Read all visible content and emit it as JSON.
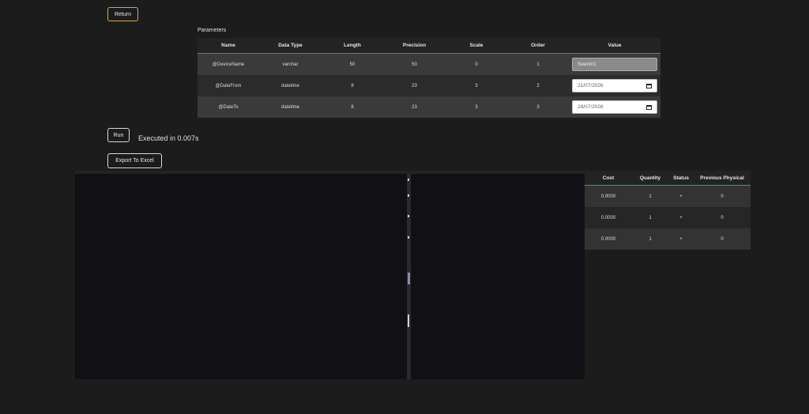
{
  "buttons": {
    "return": "Return",
    "run": "Run",
    "export": "Export To Excel"
  },
  "execution": {
    "text": "Executed in 0.007s"
  },
  "parameters": {
    "title": "Parameters",
    "headers": [
      "Name",
      "Data Type",
      "Length",
      "Precision",
      "Scale",
      "Order",
      "Value"
    ],
    "rows": [
      {
        "name": "@DeviceName",
        "type": "varchar",
        "length": "50",
        "precision": "50",
        "scale": "0",
        "order": "1",
        "value": "Seenin1"
      },
      {
        "name": "@DateFrom",
        "type": "datetime",
        "length": "8",
        "precision": "23",
        "scale": "3",
        "order": "2",
        "value": "21/07/2026"
      },
      {
        "name": "@DateTo",
        "type": "datetime",
        "length": "8",
        "precision": "23",
        "scale": "3",
        "order": "3",
        "value": "28/07/2026"
      }
    ]
  },
  "results": {
    "headers": [
      "Cost",
      "Quantity",
      "Status",
      "Previous Physical"
    ],
    "rows": [
      {
        "cost": "0.0000",
        "qty": "1",
        "status": "+",
        "prev": "0"
      },
      {
        "cost": "0.0000",
        "qty": "1",
        "status": "+",
        "prev": "0"
      },
      {
        "cost": "0.0000",
        "qty": "1",
        "status": "+",
        "prev": "0"
      }
    ]
  },
  "colors": {
    "accent": "#1fa37a",
    "return_border": "#e0a050",
    "panel": "#111115",
    "background": "#1c1c1c"
  },
  "icons": {
    "date_picker": "calendar-icon"
  }
}
